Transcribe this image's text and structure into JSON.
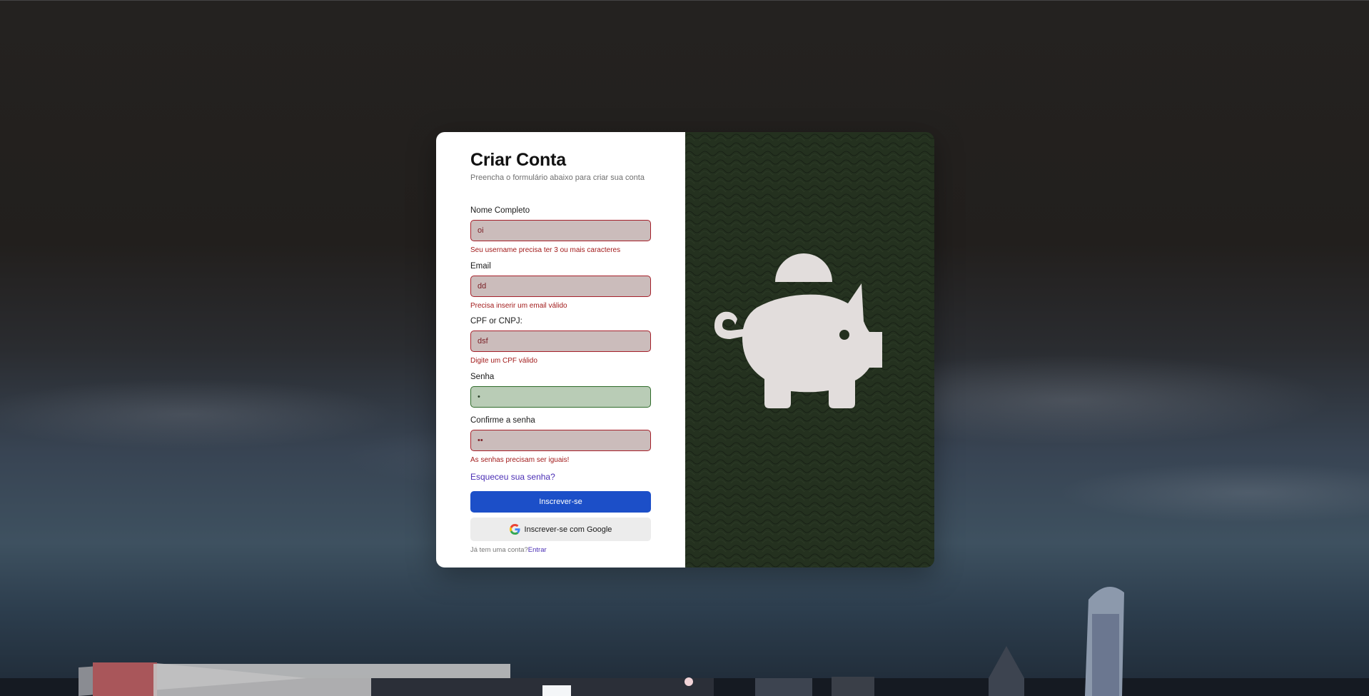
{
  "form": {
    "title": "Criar Conta",
    "subtitle": "Preencha o formulário abaixo para criar sua conta",
    "fields": {
      "name": {
        "label": "Nome Completo",
        "value": "oi",
        "error": "Seu username precisa ter 3 ou mais caracteres",
        "state": "invalid"
      },
      "email": {
        "label": "Email",
        "value": "dd",
        "error": "Precisa inserir um email válido",
        "state": "invalid"
      },
      "document": {
        "label": "CPF or CNPJ:",
        "value": "dsf",
        "error": "Digite um CPF válido",
        "state": "invalid"
      },
      "password": {
        "label": "Senha",
        "value": "•",
        "state": "valid"
      },
      "confirm": {
        "label": "Confirme a senha",
        "value": "••",
        "error": "As senhas precisam ser iguais!",
        "state": "invalid"
      }
    },
    "forgot_link": "Esqueceu sua senha?",
    "submit_label": "Inscrever-se",
    "google_label": "Inscrever-se com Google",
    "footer_text": "Já tem uma conta?",
    "footer_link": "Entrar"
  },
  "colors": {
    "error_border": "#a5202a",
    "error_fill": "#cbbcbb",
    "valid_border": "#2f6b2a",
    "valid_fill": "#b9ccb6",
    "primary": "#1c4fc8",
    "link": "#4b2fb5",
    "art_background": "#24311f",
    "pig": "#e2dddc"
  },
  "icons": [
    "piggy-bank-icon",
    "google-icon"
  ]
}
